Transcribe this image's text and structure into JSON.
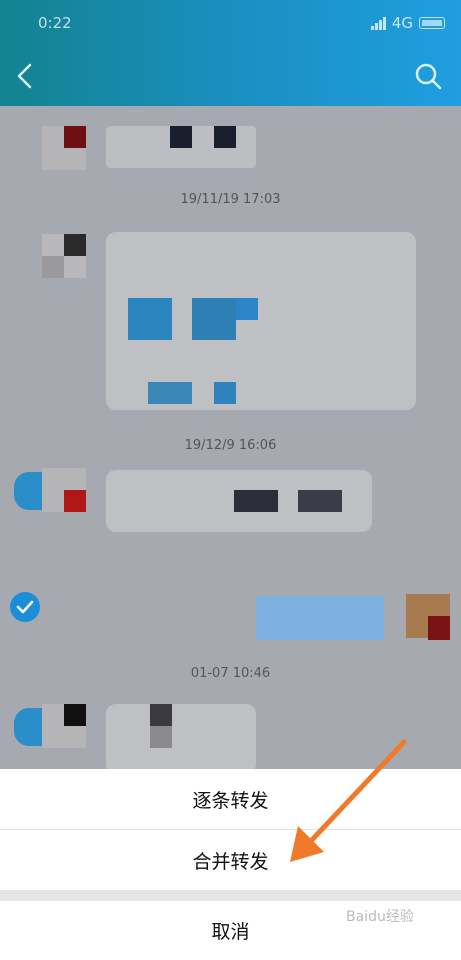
{
  "status_bar": {
    "time": "0:22",
    "network": "4G"
  },
  "header": {
    "title": ""
  },
  "chat": {
    "timestamps": [
      "19/11/19 17:03",
      "19/12/9 16:06",
      "01-07 10:46"
    ]
  },
  "sheet": {
    "option_one": "逐条转发",
    "option_two": "合并转发",
    "cancel": "取消"
  },
  "watermark": "Baidu经验",
  "colors": {
    "accent": "#1a8ed8",
    "arrow": "#f07a2a"
  }
}
